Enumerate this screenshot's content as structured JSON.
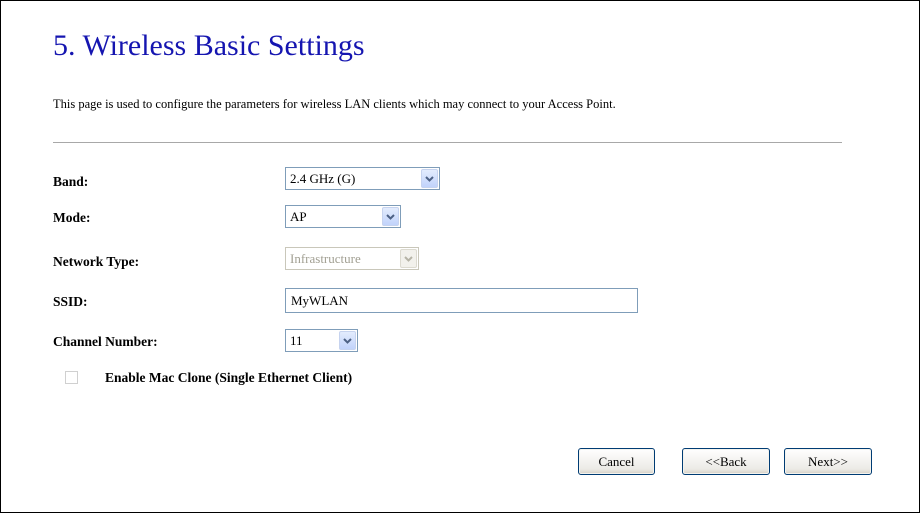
{
  "page": {
    "title": "5. Wireless Basic Settings",
    "description": "This page is used to configure the parameters for wireless LAN clients which may connect to your Access Point."
  },
  "form": {
    "band": {
      "label": "Band:",
      "value": "2.4 GHz (G)"
    },
    "mode": {
      "label": "Mode:",
      "value": "AP"
    },
    "network_type": {
      "label": "Network Type:",
      "value": "Infrastructure",
      "disabled": true
    },
    "ssid": {
      "label": "SSID:",
      "value": "MyWLAN"
    },
    "channel": {
      "label": "Channel Number:",
      "value": "11"
    },
    "mac_clone": {
      "label": "Enable Mac Clone (Single Ethernet Client)",
      "checked": false
    }
  },
  "buttons": {
    "cancel": "Cancel",
    "back": "<<Back",
    "next": "Next>>"
  },
  "colors": {
    "title": "#1515b0",
    "divider": "#a8a8a8",
    "input_border": "#7f9db9",
    "dropdown_arrow": "#4d6185",
    "button_border": "#003c74"
  },
  "icons": {
    "dropdown": "chevron-down-icon"
  }
}
